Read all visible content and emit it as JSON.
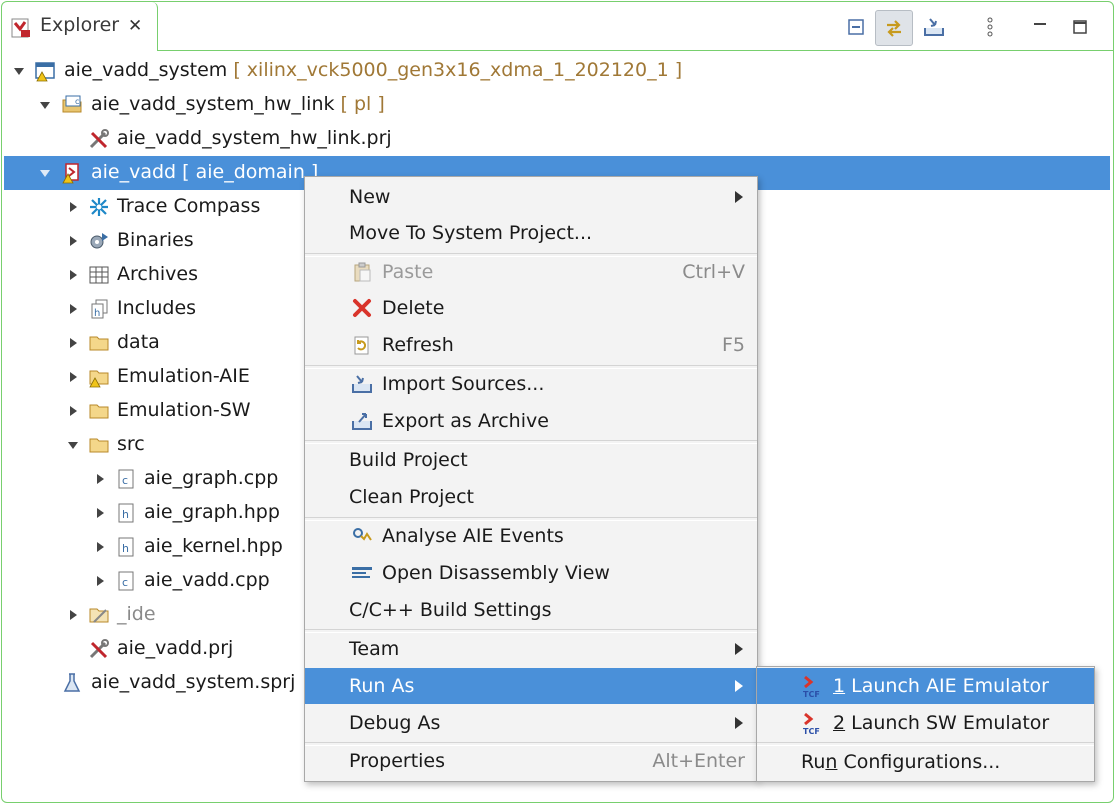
{
  "tab": {
    "title": "Explorer",
    "close_icon": "close-icon"
  },
  "toolbar": {
    "icons": [
      "collapse-all-icon",
      "link-with-editor-icon",
      "import-icon",
      "view-menu-icon",
      "minimize-icon",
      "maximize-icon"
    ]
  },
  "tree": {
    "root": {
      "label": "aie_vadd_system",
      "decoration": "[ xilinx_vck5000_gen3x16_xdma_1_202120_1 ]"
    },
    "hw_link": {
      "label": "aie_vadd_system_hw_link",
      "decoration": "[ pl ]"
    },
    "hw_link_prj": {
      "label": "aie_vadd_system_hw_link.prj"
    },
    "aie": {
      "label": "aie_vadd [ aie_domain ]"
    },
    "children": [
      {
        "label": "Trace Compass"
      },
      {
        "label": "Binaries"
      },
      {
        "label": "Archives"
      },
      {
        "label": "Includes"
      },
      {
        "label": "data"
      },
      {
        "label": "Emulation-AIE"
      },
      {
        "label": "Emulation-SW"
      },
      {
        "label": "src"
      },
      {
        "label": "aie_graph.cpp"
      },
      {
        "label": "aie_graph.hpp"
      },
      {
        "label": "aie_kernel.hpp"
      },
      {
        "label": "aie_vadd.cpp"
      },
      {
        "label": "_ide"
      },
      {
        "label": "aie_vadd.prj"
      }
    ],
    "sprj": {
      "label": "aie_vadd_system.sprj"
    }
  },
  "menu": {
    "new": "New",
    "move": "Move To System Project...",
    "paste": "Paste",
    "paste_key": "Ctrl+V",
    "delete": "Delete",
    "refresh": "Refresh",
    "refresh_key": "F5",
    "import": "Import Sources...",
    "export": "Export as Archive",
    "build": "Build Project",
    "clean": "Clean Project",
    "analyse": "Analyse AIE Events",
    "disasm": "Open Disassembly View",
    "build_settings": "C/C++ Build Settings",
    "team": "Team",
    "run_as": "Run As",
    "debug_as": "Debug As",
    "properties": "Properties",
    "properties_key": "Alt+Enter"
  },
  "submenu": {
    "launch_aie_num": "1",
    "launch_aie": " Launch AIE Emulator",
    "launch_sw_num": "2",
    "launch_sw": " Launch SW Emulator",
    "run_conf_a": "Ru",
    "run_conf_u": "n",
    "run_conf_b": " Configurations..."
  },
  "colors": {
    "accent": "#4a90d9",
    "border": "#78cf6e",
    "decoration": "#a07836"
  }
}
